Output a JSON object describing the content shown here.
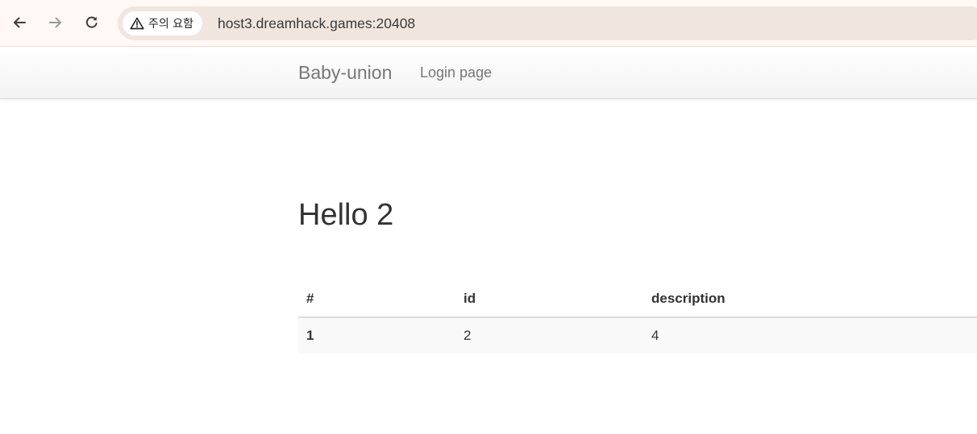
{
  "browser": {
    "security_label": "주의 요함",
    "url": "host3.dreamhack.games:20408",
    "icons": [
      "back-arrow-icon",
      "forward-arrow-icon",
      "reload-icon",
      "warning-triangle-icon"
    ]
  },
  "navbar": {
    "brand": "Baby-union",
    "links": [
      {
        "label": "Login page"
      }
    ]
  },
  "main": {
    "title": "Hello 2",
    "table": {
      "headers": [
        "#",
        "id",
        "description"
      ],
      "rows": [
        [
          "1",
          "2",
          "4"
        ]
      ]
    }
  },
  "colors": {
    "browser_bar_bg": "#fff8f4",
    "omnibox_bg": "#f1e6df",
    "navbar_text": "#777777",
    "body_text": "#333333",
    "row_stripe": "#f9f9f9"
  }
}
